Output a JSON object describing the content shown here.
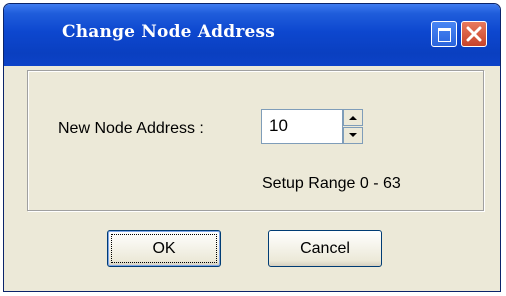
{
  "window": {
    "title": "Change Node Address"
  },
  "form": {
    "label": "New Node Address :",
    "value": "10",
    "range_text": "Setup Range 0 - 63"
  },
  "buttons": {
    "ok": "OK",
    "cancel": "Cancel"
  },
  "icons": {
    "maximize": "maximize-icon",
    "close": "close-icon",
    "spin_up": "arrow-up-icon",
    "spin_down": "arrow-down-icon"
  },
  "colors": {
    "titlebar": "#0a3fc0",
    "client": "#ece9d8",
    "close_button": "#c8432a"
  }
}
